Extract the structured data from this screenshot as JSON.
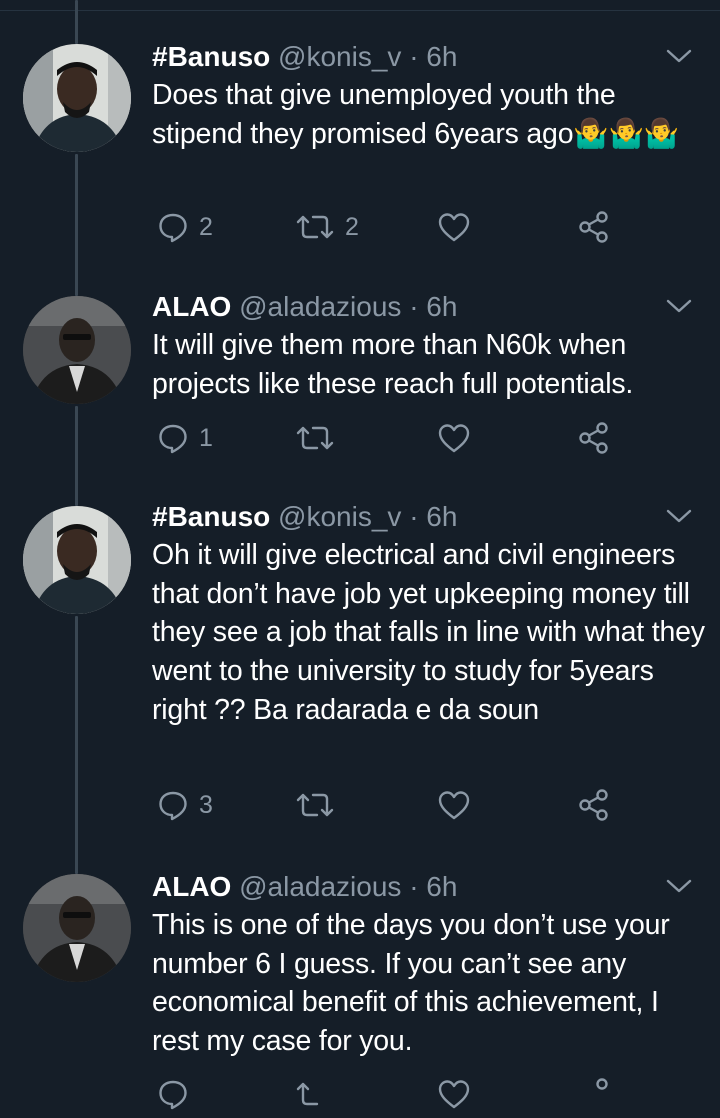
{
  "tweets": [
    {
      "display_name": "#Banuso",
      "handle": "@konis_v",
      "time": "· 6h",
      "text": "Does that give unemployed youth the stipend they promised 6years ago🤷‍♂️🤷‍♂️🤷‍♂️",
      "replies": "2",
      "retweets": "2",
      "likes": ""
    },
    {
      "display_name": "ALAO",
      "handle": "@aladazious",
      "time": "· 6h",
      "text": "It will give them more than N60k when projects like these reach full potentials.",
      "replies": "1",
      "retweets": "",
      "likes": ""
    },
    {
      "display_name": "#Banuso",
      "handle": "@konis_v",
      "time": "· 6h",
      "text": "Oh it will give electrical and civil engineers that don’t have job yet upkeeping money till they see a job that falls in line with what they went to the university to study for 5years right ?? Ba radarada e da soun",
      "replies": "3",
      "retweets": "",
      "likes": ""
    },
    {
      "display_name": "ALAO",
      "handle": "@aladazious",
      "time": "· 6h",
      "text": "This is one of the days you don’t use your number 6 I guess. If you can’t see any economical benefit of this achievement, I rest my case for you.",
      "replies": "",
      "retweets": "",
      "likes": ""
    }
  ],
  "icons": [
    "reply-icon",
    "retweet-icon",
    "like-icon",
    "share-icon",
    "chevron-down-icon"
  ],
  "colors": {
    "background": "#151e28",
    "text": "#ffffff",
    "secondary": "#8b98a5",
    "thread_line": "#3a4753"
  }
}
